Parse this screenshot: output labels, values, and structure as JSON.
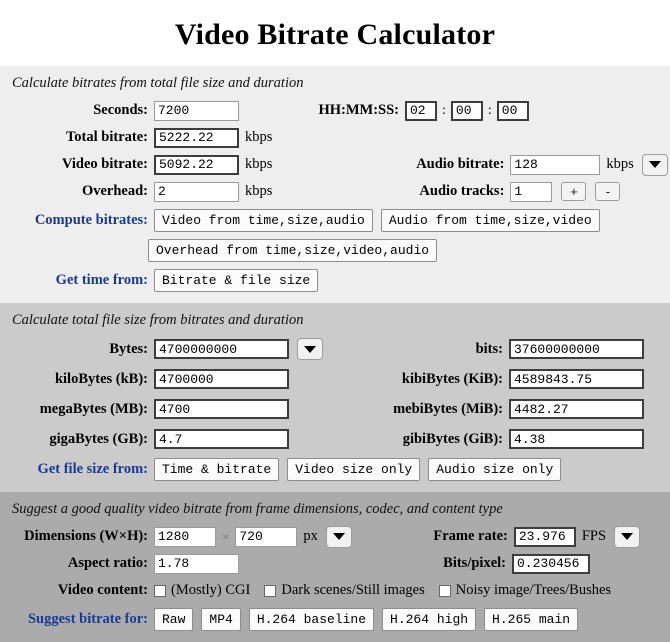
{
  "title": "Video Bitrate Calculator",
  "section1": {
    "caption": "Calculate bitrates from total file size and duration",
    "labels": {
      "seconds": "Seconds:",
      "total_bitrate": "Total bitrate:",
      "video_bitrate": "Video bitrate:",
      "overhead": "Overhead:",
      "hhmmss": "HH:MM:SS:",
      "audio_bitrate": "Audio bitrate:",
      "audio_tracks": "Audio tracks:",
      "compute_bitrates": "Compute bitrates:",
      "get_time_from": "Get time from:"
    },
    "values": {
      "seconds": "7200",
      "total_bitrate": "5222.22",
      "video_bitrate": "5092.22",
      "overhead": "2",
      "hours": "02",
      "minutes": "00",
      "seconds_hms": "00",
      "audio_bitrate": "128",
      "audio_tracks": "1"
    },
    "units": {
      "total_bitrate": "kbps",
      "video_bitrate": "kbps",
      "overhead": "kbps",
      "audio_bitrate": "kbps"
    },
    "separators": {
      "colon1": ":",
      "colon2": ":"
    },
    "buttons": {
      "video_from": "Video from time,size,audio",
      "audio_from": "Audio from time,size,video",
      "overhead_from": "Overhead from time,size,video,audio",
      "bitrate_filesize": "Bitrate & file size",
      "plus": "+",
      "minus": "-"
    }
  },
  "section2": {
    "caption": "Calculate total file size from bitrates and duration",
    "labels": {
      "bytes": "Bytes:",
      "kilobytes": "kiloBytes (kB):",
      "megabytes": "megaBytes (MB):",
      "gigabytes": "gigaBytes (GB):",
      "bits": "bits:",
      "kibibytes": "kibiBytes (KiB):",
      "mebibytes": "mebiBytes (MiB):",
      "gibibytes": "gibiBytes (GiB):",
      "get_file_size_from": "Get file size from:"
    },
    "values": {
      "bytes": "4700000000",
      "kilobytes": "4700000",
      "megabytes": "4700",
      "gigabytes": "4.7",
      "bits": "37600000000",
      "kibibytes": "4589843.75",
      "mebibytes": "4482.27",
      "gibibytes": "4.38"
    },
    "buttons": {
      "time_bitrate": "Time & bitrate",
      "video_size_only": "Video size only",
      "audio_size_only": "Audio size only"
    }
  },
  "section3": {
    "caption": "Suggest a good quality video bitrate from frame dimensions, codec, and content type",
    "labels": {
      "dimensions": "Dimensions (W×H):",
      "aspect_ratio": "Aspect ratio:",
      "frame_rate": "Frame rate:",
      "bits_pixel": "Bits/pixel:",
      "video_content": "Video content:",
      "suggest_bitrate_for": "Suggest bitrate for:"
    },
    "values": {
      "width": "1280",
      "height": "720",
      "aspect_ratio": "1.78",
      "frame_rate": "23.976",
      "bits_pixel": "0.230456"
    },
    "units": {
      "px": "px",
      "fps": "FPS"
    },
    "separator_x": "×",
    "checkboxes": [
      {
        "label": "(Mostly) CGI",
        "checked": false
      },
      {
        "label": "Dark scenes/Still images",
        "checked": false
      },
      {
        "label": "Noisy image/Trees/Bushes",
        "checked": false
      }
    ],
    "buttons": {
      "raw": "Raw",
      "mp4": "MP4",
      "h264_baseline": "H.264 baseline",
      "h264_high": "H.264 high",
      "h265_main": "H.265 main"
    }
  },
  "colors": {
    "accent_blue": "#1a3a8f",
    "section1_bg": "#eeeeee",
    "section2_bg": "#cbcbcb",
    "section3_bg": "#ababab"
  }
}
